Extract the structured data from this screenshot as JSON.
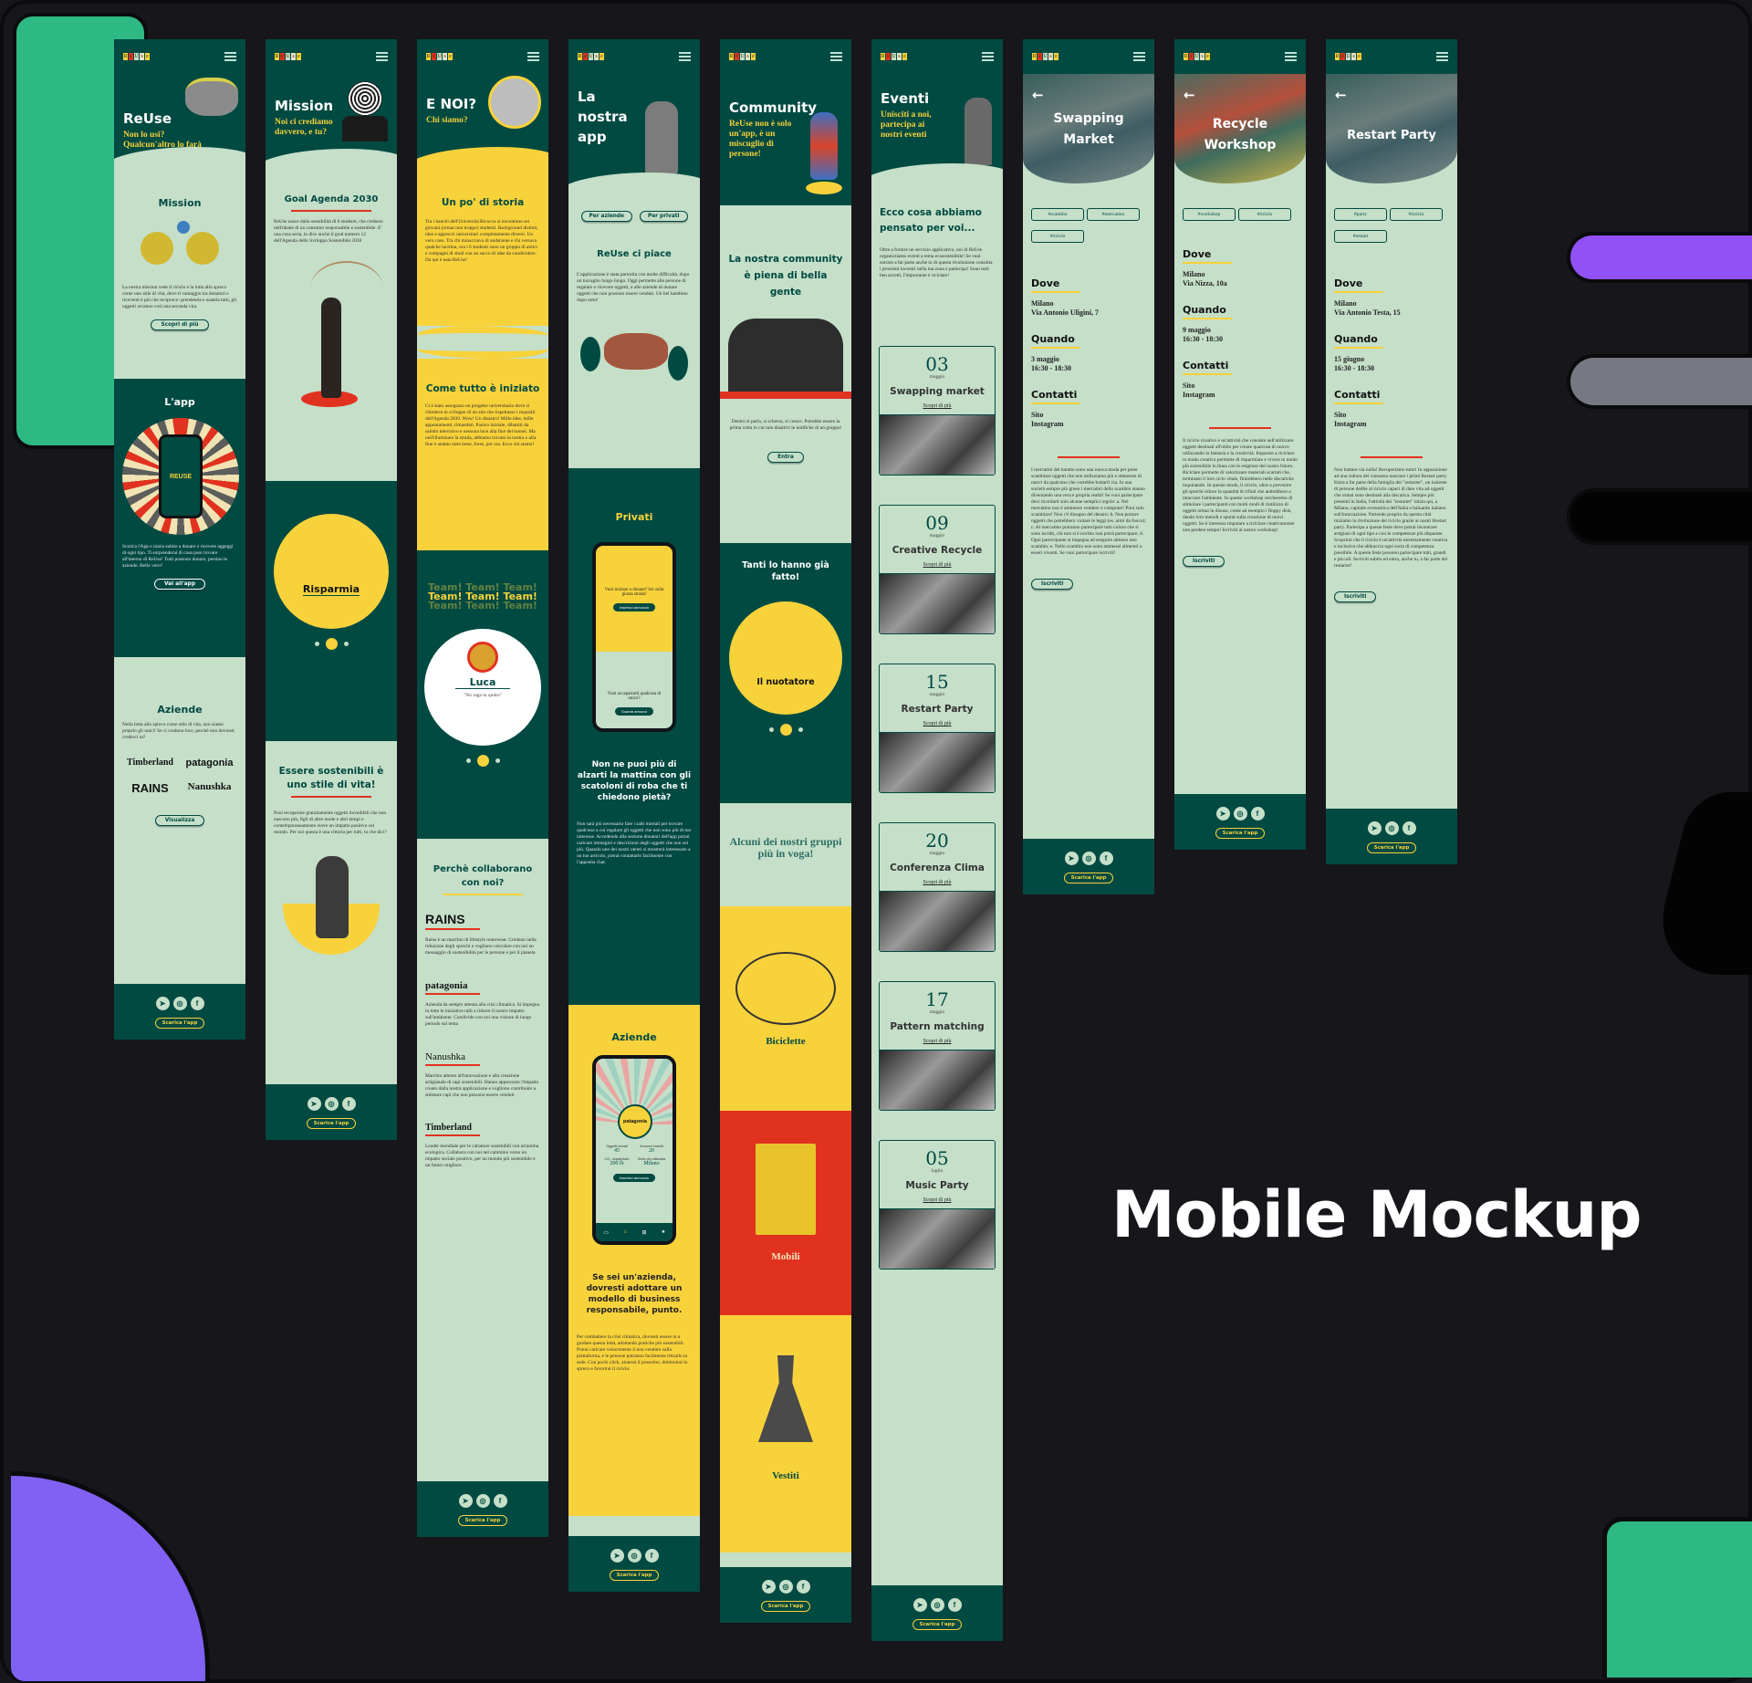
{
  "headline": "Mobile Mockup",
  "brand": {
    "logo_letters": [
      "R",
      "e",
      "U",
      "s",
      "e"
    ],
    "colors": {
      "dark": "#004a42",
      "light": "#c5dfc9",
      "yellow": "#f8d23b",
      "red": "#e1321f"
    }
  },
  "common": {
    "footer_button": "Scarica l'app",
    "social_icons": [
      "telegram-icon",
      "instagram-icon",
      "facebook-icon"
    ]
  },
  "home": {
    "title": "ReUse",
    "subtitle": "Non lo usi? Qualcun'altro lo farà",
    "mission": {
      "heading": "Mission",
      "text": "La nostra mission vede il riciclo e la lotta allo spreco come uno stile di vita, dove il vantaggio tra donatori e riceventi è più che reciproco: prendetela e usatela tutti, gli oggetti avranno così una seconda vita.",
      "button": "Scopri di più"
    },
    "app": {
      "heading": "L'app",
      "phone_label": "REUSE",
      "text": "Scarica l'App e inizia subito a donare o ricevere aggeggi di ogni tipo. Ti sorprenderai di cosa puoi trovare all'interno di ReUse! Tutti possono donare, persino le aziende. Bello vero?",
      "button": "Vai all'app"
    },
    "aziende": {
      "heading": "Aziende",
      "text": "Nella lotta allo spreco come stile di vita, non siamo proprio gli unici! Se ci credono loro, perchè non dovresti crederci tu?",
      "brands": [
        "Timberland",
        "patagonia",
        "RAINS",
        "Nanushka"
      ],
      "button": "Visualizza"
    }
  },
  "mission_page": {
    "title": "Mission",
    "subtitle": "Noi ci crediamo davvero, e tu?",
    "goal": {
      "heading": "Goal Agenda 2030",
      "text": "ReUse nasce dalla sensibilità di 6 studenti, che credono nell'ideale di un consumo responsabile e sostenibile. E' una cosa seria, lo dice anche il goal numero 12 dell'Agenda dello Sviluppo Sostenibile 2030"
    },
    "carousel_label": "Risparmia",
    "carousel_active": 2,
    "carousel_count": 3,
    "sustain": {
      "heading": "Essere sostenibili è uno stile di vita!",
      "text": "Puoi recuperare gratuitamente oggetti incredibili che non nascono più, figli di altre mode e altri tempi e contemporaneamente avere un impatto positivo sul mondo. Per noi questa è una vittoria per tutti, tu che dici?"
    }
  },
  "about": {
    "title": "E NOI?",
    "subtitle": "Chi siamo?",
    "history": {
      "heading": "Un po' di storia",
      "text": "Tra i banchi dell'Università Bicocca si incontrano sei giovani (ormai non troppo) studenti. Background distinti, idee e approcci universitari completamente diversi. Un vero caos. Tra chi minacciava di andarsene e chi versava qualche lacrima, ora i 6 studenti sono un gruppo di amici e compagni di studi con un sacco di idee da condividere. Da qui è nata ReUse!"
    },
    "start": {
      "heading": "Come tutto è iniziato",
      "text": "Ci è stato assegnato un progetto universitario dove si chiedeva lo sviluppo di un sito che rispettasse i requisiti dell'Agenda 2030. Wow! Un disastro! Mille idee, mille appuntamenti, rimandati. Panico iniziale, dibattiti da salotto televisivo e nessuna luce alla fine del tunnel. Ma nell'illuminare la strada, abbiamo trovato la nostra e alla fine è andato tutto bene, forse, per ora. Ecco chi siamo!"
    },
    "team_label": "Team! Team! Team!",
    "member": {
      "name": "Luca",
      "quote": "\"No raga io quitto\""
    },
    "carousel_active": 2,
    "carousel_count": 3,
    "partners": {
      "heading": "Perchè collaborano con noi?",
      "items": [
        {
          "brand": "RAINS",
          "text": "Rains è un marchio di lifestyle outerwear. Credono nella riduzione degli sprechi e vogliono veicolare con noi un messaggio di sostenibilità per le persone e per il pianeta"
        },
        {
          "brand": "patagonia",
          "text": "Azienda da sempre attenta alla crisi climatica. Si impegna in tutte le iniziative utili a ridurre il nostro impatto sull'ambiente. Condivide con noi una visione di lungo periodo sul tema"
        },
        {
          "brand": "Nanushka",
          "text": "Marchio attento all'innovazione e alla creazione artigianale di capi sostenibili. Hanno apprezzato l'impatto creato dalla nostra applicazione e vogliono contribuire a smistare capi che non possono essere venduti"
        },
        {
          "brand": "Timberland",
          "text": "Leader mondiale per le calzature sostenibili con un'anima ecologica. Collabora con noi nel cammino verso un impatto sociale positivo, per un mondo più sostenibile e un futuro migliore."
        }
      ]
    }
  },
  "app_page": {
    "title": "La nostra app",
    "tabs": [
      "Per aziende",
      "Per privati"
    ],
    "intro": {
      "heading": "ReUse ci piace",
      "text": "L'applicazione è stata partorita con molte difficoltà, dopo un travaglio lungo lungo. Oggi permette alle persone di regalare o ricevere oggetti, e alle aziende di donare oggetti che non possono essere venduti. Un bel bambino dopo tutto!"
    },
    "privati": {
      "heading": "Privati",
      "phone": {
        "q1": "Vuoi iniziare a donare? Sei sulla giusta strada!",
        "b1": "Inserisci annuncio",
        "q2": "Vuoi accaparrarti qualcosa di unico?",
        "b2": "Guarda annunci"
      },
      "question": "Non ne puoi più di alzarti la mattina con gli scatoloni di roba che ti chiedono pietà?",
      "text": "Non sarà più necessario fare i salti mortali per trovare qualcuno a cui regalare gli oggetti che non sono più di tuo interesse. Accedendo alla sezione donatori dell'app potrai caricare immagini e descrizioni degli oggetti che non usi più. Quando uno dei nostri utenti si mostrerà interessato a un tuo articolo, potrai contattarlo facilmente con l'apposita chat."
    },
    "aziende": {
      "heading": "Aziende",
      "phone": {
        "company": "patagonia",
        "stats": [
          {
            "label": "Oggetti donati",
            "value": "45"
          },
          {
            "label": "Annunci inseriti",
            "value": "20"
          },
          {
            "label": "CO₂ risparmiato",
            "value": "200 lb"
          },
          {
            "label": "Sede più utilizzata",
            "value": "Milano"
          }
        ],
        "button": "Inserisci annuncio",
        "nav": [
          "Messaggi",
          "Home",
          "Aggiungi",
          "Il mio profilo"
        ]
      },
      "question": "Se sei un'azienda, dovresti adottare un modello di business responsabile, punto.",
      "text": "Per combattere la crisi climatica, dovresti essere tu a guidare questa lotta, adottando pratiche più sostenibili. Potrai caricare velocemente il non venduto sulla piattaforma, e le persone potranno facilmente ritirarlo in sede. Con pochi click, aiuterai il prossimo, diminuirai lo spreco e favorirai il riciclo."
    }
  },
  "community": {
    "title": "Community",
    "subtitle": "ReUse non è solo un'app, è un miscuglio di persone!",
    "intro": {
      "heading": "La nostra community è piena di bella gente",
      "text": "Dentro si parla, si scherza, si cresce. Potrebbe essere la prima volta in cui non disattivi le notifiche di un gruppo!",
      "button": "Entra"
    },
    "done": {
      "heading": "Tanti lo hanno già fatto!",
      "label": "Il nuotatore",
      "carousel_active": 2,
      "carousel_count": 3
    },
    "groups_heading": "Alcuni dei nostri gruppi più in voga!",
    "groups": [
      "Biciclette",
      "Mobili",
      "Vestiti"
    ]
  },
  "events": {
    "title": "Eventi",
    "subtitle": "Unisciti a noi, partecipa ai nostri eventi",
    "heading": "Ecco cosa abbiamo pensato per voi...",
    "text": "Oltre a fornire un servizio applicativo, noi di ReUse organizziamo eventi a tema ecosostenibile! Se vuoi entrare a far parte anche tu di questa rivoluzione consulta i prossimi incontri nella tua zona e partecipa! Sono tutti ben accetti, l'importante è riciclare!",
    "more_label": "Scopri di più",
    "items": [
      {
        "day": "03",
        "month": "maggio",
        "title": "Swapping market"
      },
      {
        "day": "09",
        "month": "maggio",
        "title": "Creative Recycle"
      },
      {
        "day": "15",
        "month": "maggio",
        "title": "Restart Party"
      },
      {
        "day": "20",
        "month": "maggio",
        "title": "Conferenza Clima"
      },
      {
        "day": "17",
        "month": "maggio",
        "title": "Pattern matching"
      },
      {
        "day": "05",
        "month": "luglio",
        "title": "Music Party"
      }
    ]
  },
  "details": [
    {
      "title": "Swapping Market",
      "tags": [
        "#scambio",
        "#mercatino",
        "#riciclo"
      ],
      "dove": "Milano\nVia Antonio Uligini, 7",
      "quando": "3 maggio\n16:30 - 18:30",
      "contatti": "Sito\nInstagram",
      "text": "I mercatini del baratto sono una nuova moda per poter scambiare oggetti che non utilizziamo più e ottenerne di nuovi da qualcuno che vorrebbe buttarli via. In una società sempre più green i mercatini dello scambio stanno diventando una vera e propria realtà! Se vuoi partecipare devi ricordarti solo alcune semplici regole: a. Nel mercatino non è ammesso vendere o comprare! Puoi solo scambiare! Non c'è bisogno del denaro; b. Non portare oggetti che potrebbero violare le leggi (es. armi da fuoco); c. Al mercatino potranno partecipare tutti coloro che si sono iscritti, chi non si è iscritto non potrà partecipare; d. Ogni partecipante si impegna ad eseguire almeno uno scambio; e. Nello scambio non sono ammessi alimenti o esseri viventi. Se vuoi partecipare iscriviti!",
      "button": "Iscriviti"
    },
    {
      "title": "Recycle Workshop",
      "tags": [
        "#workshop",
        "#riciclo"
      ],
      "dove": "Milano\nVia Nizza, 10a",
      "quando": "9 maggio\n16:30 - 18:30",
      "contatti": "Sito\nInstagram",
      "text": "Il riciclo creativo è un'attività che consiste nell'utilizzare oggetti destinati all'oblio per creare qualcosa di nuovo utilizzando la fantasia e la creatività. Imparare a riciclare in modo creativo permette di risparmiare e vivere in modo più sostenibile in linea con le esigenze del nostro futuro. Riciclare permette di valorizzare materiali scartati che, terminato il loro ciclo vitale, finirebbero nelle discariche inquinando. In questo modo, il riciclo, oltre a prevenire gli sprechi riduce la quantità di rifiuti che andrebbero a intaccare l'ambiente. In questo workshop cercheremo di stimolare i partecipanti con molti modi di riutilizzo di oggetti ormai in disuso, come ad esempio i floppy disk, dando loro metodi e spunti sulla creazione di nuovi oggetti. Se ti interessa imparare a riciclare creativamente non perdere tempo! Iscriviti al nostro workshop!",
      "button": "Iscriviti"
    },
    {
      "title": "Restart Party",
      "tags": [
        "#party",
        "#riciclo",
        "#restart"
      ],
      "dove": "Milano\nVia Antonio Testa, 15",
      "quando": "15 giugno\n16:30 - 18:30",
      "contatti": "Sito\nInstagram",
      "text": "Non buttare via nulla! Recuperiamo tutto! In opposizione ad una cultura del consumo nascono i primi Restart party. Entra a far parte della famiglia dei \"restarter\", un insieme di persone dedite al riciclo capaci di dare vita ad oggetti che ormai sono destinati alla discarica. Sempre più presenti in Italia, l'attività dei \"restarter\" inizia qui, a Milano, capitale economica dell'Italia e baluardo italiano sull'innovazione. Partendo proprio da questa città iniziamo la rivoluzione del riciclo grazie ai nostri Restart party. Partecipa a queste feste dove potrai incontrare artigiani di ogni tipo e con le competenze più disparate. Scoprirai che il riciclo è un'attività estremamente creativa e inclusiva che abbraccia ogni sorta di competenza possibile. A queste feste possono partecipare tutti, grandi e piccoli. Iscriviti subito ed entra, anche tu, a far parte dei restarter!",
      "button": "Iscriviti"
    }
  ],
  "detail_labels": {
    "dove": "Dove",
    "quando": "Quando",
    "contatti": "Contatti"
  }
}
